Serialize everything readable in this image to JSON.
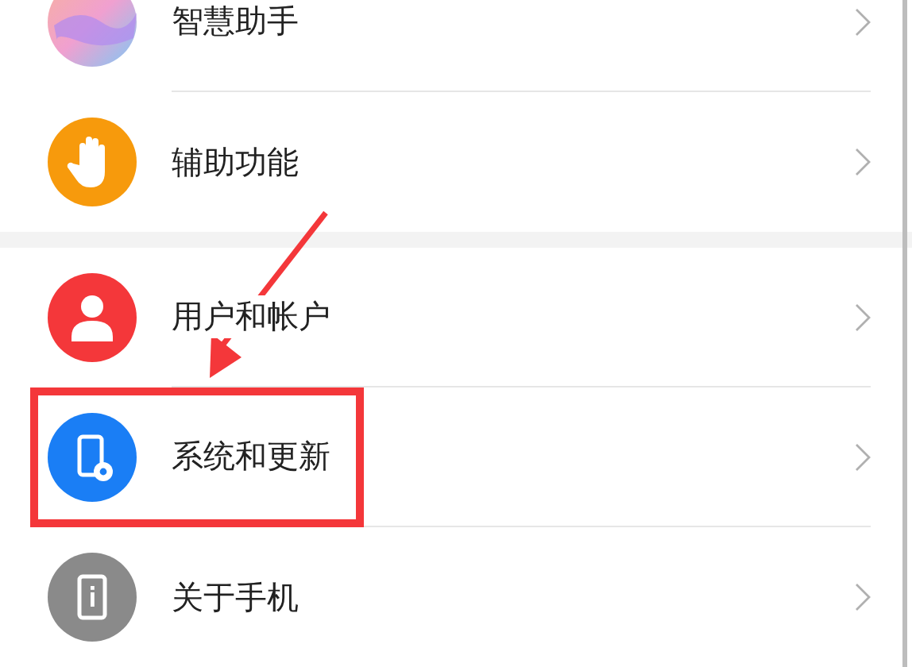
{
  "groups": [
    {
      "items": [
        {
          "label": "智慧助手",
          "kind": "orb",
          "color": "#f0a0d0",
          "highlighted": false
        },
        {
          "label": "辅助功能",
          "kind": "hand",
          "color": "#f79a0c",
          "highlighted": false
        }
      ]
    },
    {
      "items": [
        {
          "label": "用户和帐户",
          "kind": "person",
          "color": "#f4373a",
          "highlighted": false
        },
        {
          "label": "系统和更新",
          "kind": "phone-gear",
          "color": "#1a7ef5",
          "highlighted": true
        },
        {
          "label": "关于手机",
          "kind": "phone-info",
          "color": "#8a8a8a",
          "highlighted": false
        }
      ]
    }
  ]
}
